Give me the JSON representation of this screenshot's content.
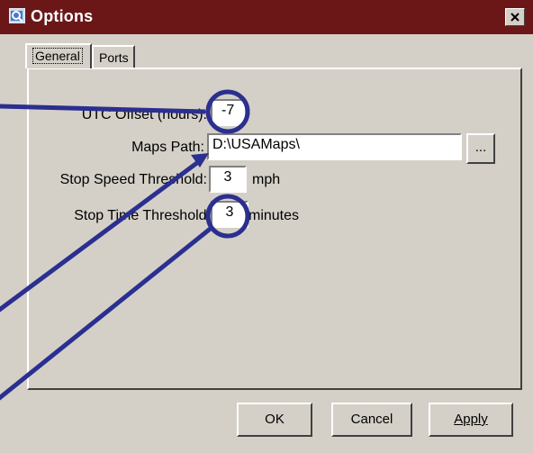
{
  "window": {
    "title": "Options",
    "icons": {
      "app": "magnifier-map-icon",
      "close": "close-icon"
    }
  },
  "tabs": [
    {
      "label": "General",
      "selected": true
    },
    {
      "label": "Ports",
      "selected": false
    }
  ],
  "general": {
    "utc_offset": {
      "label": "UTC Offset (hours):",
      "value": "-7"
    },
    "maps_path": {
      "label": "Maps Path:",
      "value": "D:\\USAMaps\\",
      "browse_label": "..."
    },
    "stop_speed": {
      "label": "Stop Speed Threshold:",
      "value": "3",
      "unit": "mph"
    },
    "stop_time": {
      "label": "Stop Time Threshold:",
      "value": "3",
      "unit": "minutes"
    }
  },
  "buttons": {
    "ok": "OK",
    "cancel": "Cancel",
    "apply": "Apply"
  },
  "colors": {
    "titlebar": "#6b1718",
    "dialog": "#d4d0c8",
    "annotation": "#2b2f8f"
  }
}
